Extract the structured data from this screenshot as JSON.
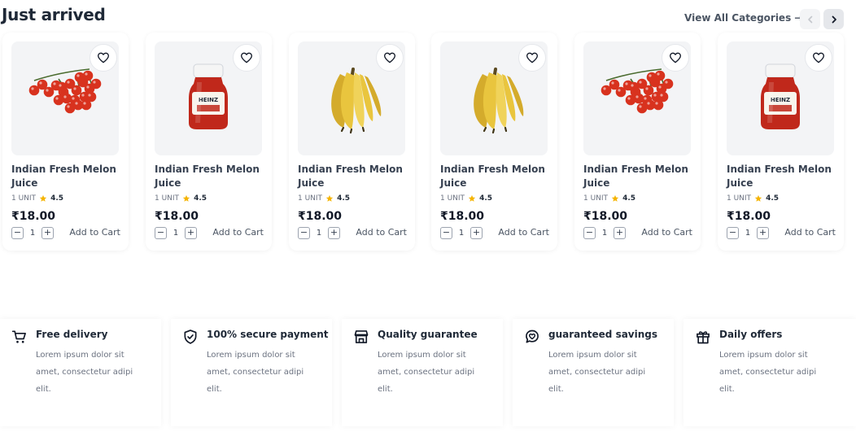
{
  "header": {
    "title": "Just arrived",
    "view_all": "View All Categories",
    "arrow": "→",
    "prev_icon": "chevron-left-icon",
    "next_icon": "chevron-right-icon"
  },
  "products": [
    {
      "image": "cherry-tomatoes",
      "name": "Indian Fresh Melon Juice",
      "unit": "1 UNIT",
      "rating": "4.5",
      "price": "₹18.00",
      "qty": "1",
      "add_label": "Add to Cart"
    },
    {
      "image": "ketchup-bottle",
      "name": "Indian Fresh Melon Juice",
      "unit": "1 UNIT",
      "rating": "4.5",
      "price": "₹18.00",
      "qty": "1",
      "add_label": "Add to Cart"
    },
    {
      "image": "bananas",
      "name": "Indian Fresh Melon Juice",
      "unit": "1 UNIT",
      "rating": "4.5",
      "price": "₹18.00",
      "qty": "1",
      "add_label": "Add to Cart"
    },
    {
      "image": "bananas",
      "name": "Indian Fresh Melon Juice",
      "unit": "1 UNIT",
      "rating": "4.5",
      "price": "₹18.00",
      "qty": "1",
      "add_label": "Add to Cart"
    },
    {
      "image": "cherry-tomatoes",
      "name": "Indian Fresh Melon Juice",
      "unit": "1 UNIT",
      "rating": "4.5",
      "price": "₹18.00",
      "qty": "1",
      "add_label": "Add to Cart"
    },
    {
      "image": "ketchup-bottle",
      "name": "Indian Fresh Melon Juice",
      "unit": "1 UNIT",
      "rating": "4.5",
      "price": "₹18.00",
      "qty": "1",
      "add_label": "Add to Cart"
    }
  ],
  "ketchup_label": "HEINZ",
  "features": [
    {
      "icon": "cart-icon",
      "title": "Free delivery",
      "desc_lines": [
        "Lorem ipsum dolor sit",
        "amet, consectetur adipi",
        "elit."
      ]
    },
    {
      "icon": "shield-check-icon",
      "title": "100% secure payment",
      "desc_lines": [
        "Lorem ipsum dolor sit",
        "amet, consectetur adipi",
        "elit."
      ]
    },
    {
      "icon": "store-icon",
      "title": "Quality guarantee",
      "desc_lines": [
        "Lorem ipsum dolor sit",
        "amet, consectetur adipi",
        "elit."
      ]
    },
    {
      "icon": "savings-icon",
      "title": "guaranteed savings",
      "desc_lines": [
        "Lorem ipsum dolor sit",
        "amet, consectetur adipi",
        "elit."
      ]
    },
    {
      "icon": "gift-icon",
      "title": "Daily offers",
      "desc_lines": [
        "Lorem ipsum dolor sit",
        "amet, consectetur adipi",
        "elit."
      ]
    }
  ],
  "colors": {
    "star": "#f5b400",
    "tomato": "#d8321e",
    "banana": "#e9c53e",
    "ketchup": "#c0281b"
  }
}
